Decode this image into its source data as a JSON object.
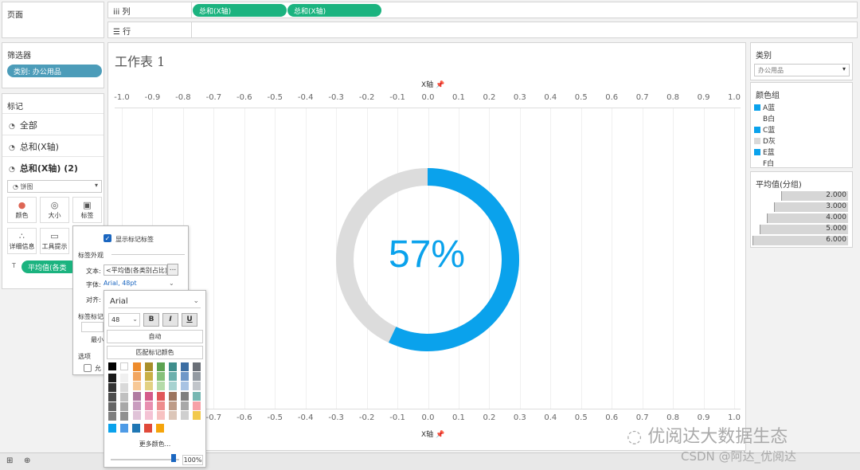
{
  "left_panels": {
    "pages_title": "页面",
    "filters_title": "筛选器",
    "filter_pill": "类别: 办公用品",
    "marks_title": "标记",
    "marks_rows": [
      "全部",
      "总和(X轴)",
      "总和(X轴) (2)"
    ],
    "mark_type": "饼图",
    "mark_buttons": [
      {
        "label": "颜色",
        "icon": "palette-icon"
      },
      {
        "label": "大小",
        "icon": "size-icon"
      },
      {
        "label": "标签",
        "icon": "label-icon"
      },
      {
        "label": "详细信息",
        "icon": "detail-icon"
      },
      {
        "label": "工具提示",
        "icon": "tooltip-icon"
      }
    ],
    "field_pill": "平均值(各类"
  },
  "shelves": {
    "columns_label": "列",
    "rows_label": "行",
    "column_pills": [
      "总和(X轴)",
      "总和(X轴)"
    ]
  },
  "worksheet": {
    "title": "工作表 1",
    "top_axis_title": "X轴",
    "bottom_axis_title": "X轴",
    "top_ticks": [
      "-1.0",
      "-0.9",
      "-0.8",
      "-0.7",
      "-0.6",
      "-0.5",
      "-0.4",
      "-0.3",
      "-0.2",
      "-0.1",
      "0.0",
      "0.1",
      "0.2",
      "0.3",
      "0.4",
      "0.5",
      "0.6",
      "0.7",
      "0.8",
      "0.9",
      "1.0"
    ],
    "bottom_ticks": [
      "-0.7",
      "-0.6",
      "-0.5",
      "-0.4",
      "-0.3",
      "-0.2",
      "-0.1",
      "0.0",
      "0.1",
      "0.2",
      "0.3",
      "0.4",
      "0.5",
      "0.6",
      "0.7",
      "0.8",
      "0.9",
      "1.0"
    ],
    "percent_label": "57%",
    "donut_fraction": 0.57,
    "donut_color": "#0aa2ec",
    "donut_bg_color": "#dcdcdc"
  },
  "right_panels": {
    "category_title": "类别",
    "category_value": "办公用品",
    "color_group_title": "颜色组",
    "color_groups": [
      {
        "label": "A蓝",
        "color": "#0aa2ec"
      },
      {
        "label": "B白",
        "color": "#ffffff"
      },
      {
        "label": "C蓝",
        "color": "#0aa2ec"
      },
      {
        "label": "D灰",
        "color": "#d9d9d9"
      },
      {
        "label": "E蓝",
        "color": "#0aa2ec"
      },
      {
        "label": "F白",
        "color": "#ffffff"
      }
    ],
    "avg_title": "平均值(分组)",
    "avg_values": [
      {
        "label": "2.000",
        "value": 2.0
      },
      {
        "label": "3.000",
        "value": 3.0
      },
      {
        "label": "4.000",
        "value": 4.0
      },
      {
        "label": "5.000",
        "value": 5.0
      },
      {
        "label": "6.000",
        "value": 6.0
      }
    ]
  },
  "label_dialog": {
    "show_labels": "显示标记标签",
    "appearance_title": "标签外观",
    "text_label": "文本:",
    "text_value": "<平均值(各类别占比)>",
    "text_more": "...",
    "font_label": "字体:",
    "font_value": "Arial, 48pt",
    "align_label": "对齐:",
    "marks_label_partial": "标签标记",
    "min_partial": "最小",
    "options_label": "选项",
    "allow_partial": "允"
  },
  "font_popup": {
    "family": "Arial",
    "size": "48",
    "bold": "B",
    "italic": "I",
    "underline": "U",
    "auto": "自动",
    "match_color": "匹配标记颜色",
    "more_colors": "更多颜色...",
    "opacity": "100%",
    "top_colors": [
      "#000000",
      "#ffffff"
    ],
    "palette_columns": [
      [
        "#ee8b2b",
        "#f2a660",
        "#f7c896"
      ],
      [
        "#a88f2a",
        "#c9b046",
        "#e3d183"
      ],
      [
        "#5da352",
        "#86c17a",
        "#b5dba9"
      ],
      [
        "#3f8e8c",
        "#6cb0ad",
        "#a7d2d0"
      ],
      [
        "#3c6ea3",
        "#6f98c8",
        "#a8c3e3"
      ],
      [
        "#6a6f77",
        "#939aa2",
        "#c1c5ca"
      ]
    ],
    "palette_columns_2": [
      [
        "#b07aa1",
        "#c99cbf",
        "#e0c3d8"
      ],
      [
        "#d55a8a",
        "#e88fb0",
        "#f4c2d4"
      ],
      [
        "#e15759",
        "#ee8d8e",
        "#f7c1c1"
      ],
      [
        "#9c755f",
        "#be9c88",
        "#dcc6b8"
      ],
      [
        "#7f7f7f",
        "#a8a8a8",
        "#cfcfcf"
      ],
      [
        "#76b7b2",
        "#f7a1a7",
        "#f2c94c"
      ]
    ],
    "gray_columns": [
      [
        "#1a1a1a",
        "#333333",
        "#4d4d4d",
        "#666666",
        "#808080"
      ],
      [
        "#f0f0f0",
        "#d9d9d9",
        "#c0c0c0",
        "#a8a8a8",
        "#909090"
      ]
    ],
    "recent_colors": [
      "#0aa2ec",
      "#4e9be6",
      "#1f77b4",
      "#e04a3a",
      "#f5a40b"
    ]
  },
  "watermarks": {
    "wechat": "优阅达大数据生态",
    "csdn": "CSDN @阿达_优阅达"
  }
}
